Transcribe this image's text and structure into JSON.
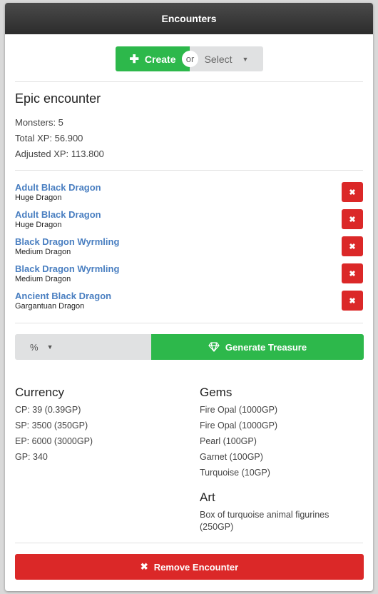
{
  "header": {
    "title": "Encounters"
  },
  "actions": {
    "create_label": "Create",
    "or_label": "or",
    "select_label": "Select"
  },
  "encounter": {
    "title": "Epic encounter",
    "monsters_text": "Monsters: 5",
    "total_xp_text": "Total XP: 56.900",
    "adjusted_xp_text": "Adjusted XP: 113.800"
  },
  "monsters": [
    {
      "name": "Adult Black Dragon",
      "type": "Huge Dragon"
    },
    {
      "name": "Adult Black Dragon",
      "type": "Huge Dragon"
    },
    {
      "name": "Black Dragon Wyrmling",
      "type": "Medium Dragon"
    },
    {
      "name": "Black Dragon Wyrmling",
      "type": "Medium Dragon"
    },
    {
      "name": "Ancient Black Dragon",
      "type": "Gargantuan Dragon"
    }
  ],
  "treasure": {
    "percent_label": "%",
    "generate_label": "Generate Treasure",
    "currency_title": "Currency",
    "currency": [
      "CP: 39 (0.39GP)",
      "SP: 3500 (350GP)",
      "EP: 6000 (3000GP)",
      "GP: 340"
    ],
    "gems_title": "Gems",
    "gems": [
      "Fire Opal (1000GP)",
      "Fire Opal (1000GP)",
      "Pearl (100GP)",
      "Garnet (100GP)",
      "Turquoise (10GP)"
    ],
    "art_title": "Art",
    "art": [
      "Box of turquoise animal figurines (250GP)"
    ]
  },
  "footer": {
    "remove_label": "Remove Encounter"
  },
  "icons": {
    "plus": "plus-icon",
    "caret": "caret-down-icon",
    "delete": "close-icon",
    "gem": "diamond-icon"
  },
  "colors": {
    "green": "#2db84b",
    "red": "#db2828",
    "link": "#4a7fc1",
    "header": "#3a3a3a"
  }
}
